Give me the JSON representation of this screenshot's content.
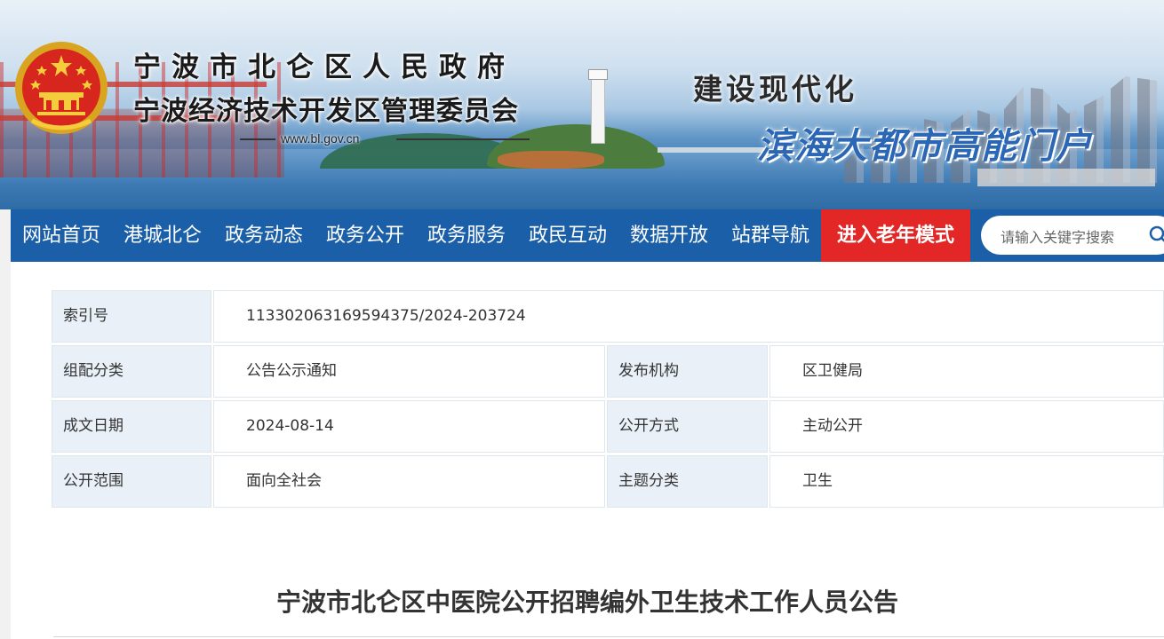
{
  "header": {
    "title_line1": "宁波市北仑区人民政府",
    "title_line2": "宁波经济技术开发区管理委员会",
    "website": "www.bl.gov.cn",
    "slogan_line1": "建设现代化",
    "slogan_line2": "滨海大都市高能门户"
  },
  "nav": {
    "items": [
      {
        "label": "网站首页"
      },
      {
        "label": "港城北仑"
      },
      {
        "label": "政务动态"
      },
      {
        "label": "政务公开"
      },
      {
        "label": "政务服务"
      },
      {
        "label": "政民互动"
      },
      {
        "label": "数据开放"
      },
      {
        "label": "站群导航"
      }
    ],
    "elder_mode_label": "进入老年模式",
    "search_placeholder": "请输入关键字搜索"
  },
  "info": {
    "index_label": "索引号",
    "index_value": "113302063169594375/2024-203724",
    "category_label": "组配分类",
    "category_value": "公告公示通知",
    "publisher_label": "发布机构",
    "publisher_value": "区卫健局",
    "date_label": "成文日期",
    "date_value": "2024-08-14",
    "method_label": "公开方式",
    "method_value": "主动公开",
    "scope_label": "公开范围",
    "scope_value": "面向全社会",
    "topic_label": "主题分类",
    "topic_value": "卫生"
  },
  "article": {
    "title": "宁波市北仑区中医院公开招聘编外卫生技术工作人员公告"
  },
  "colors": {
    "nav_bg": "#1a5fa8",
    "elder_bg": "#e22726",
    "label_bg": "#e9f0f8"
  }
}
